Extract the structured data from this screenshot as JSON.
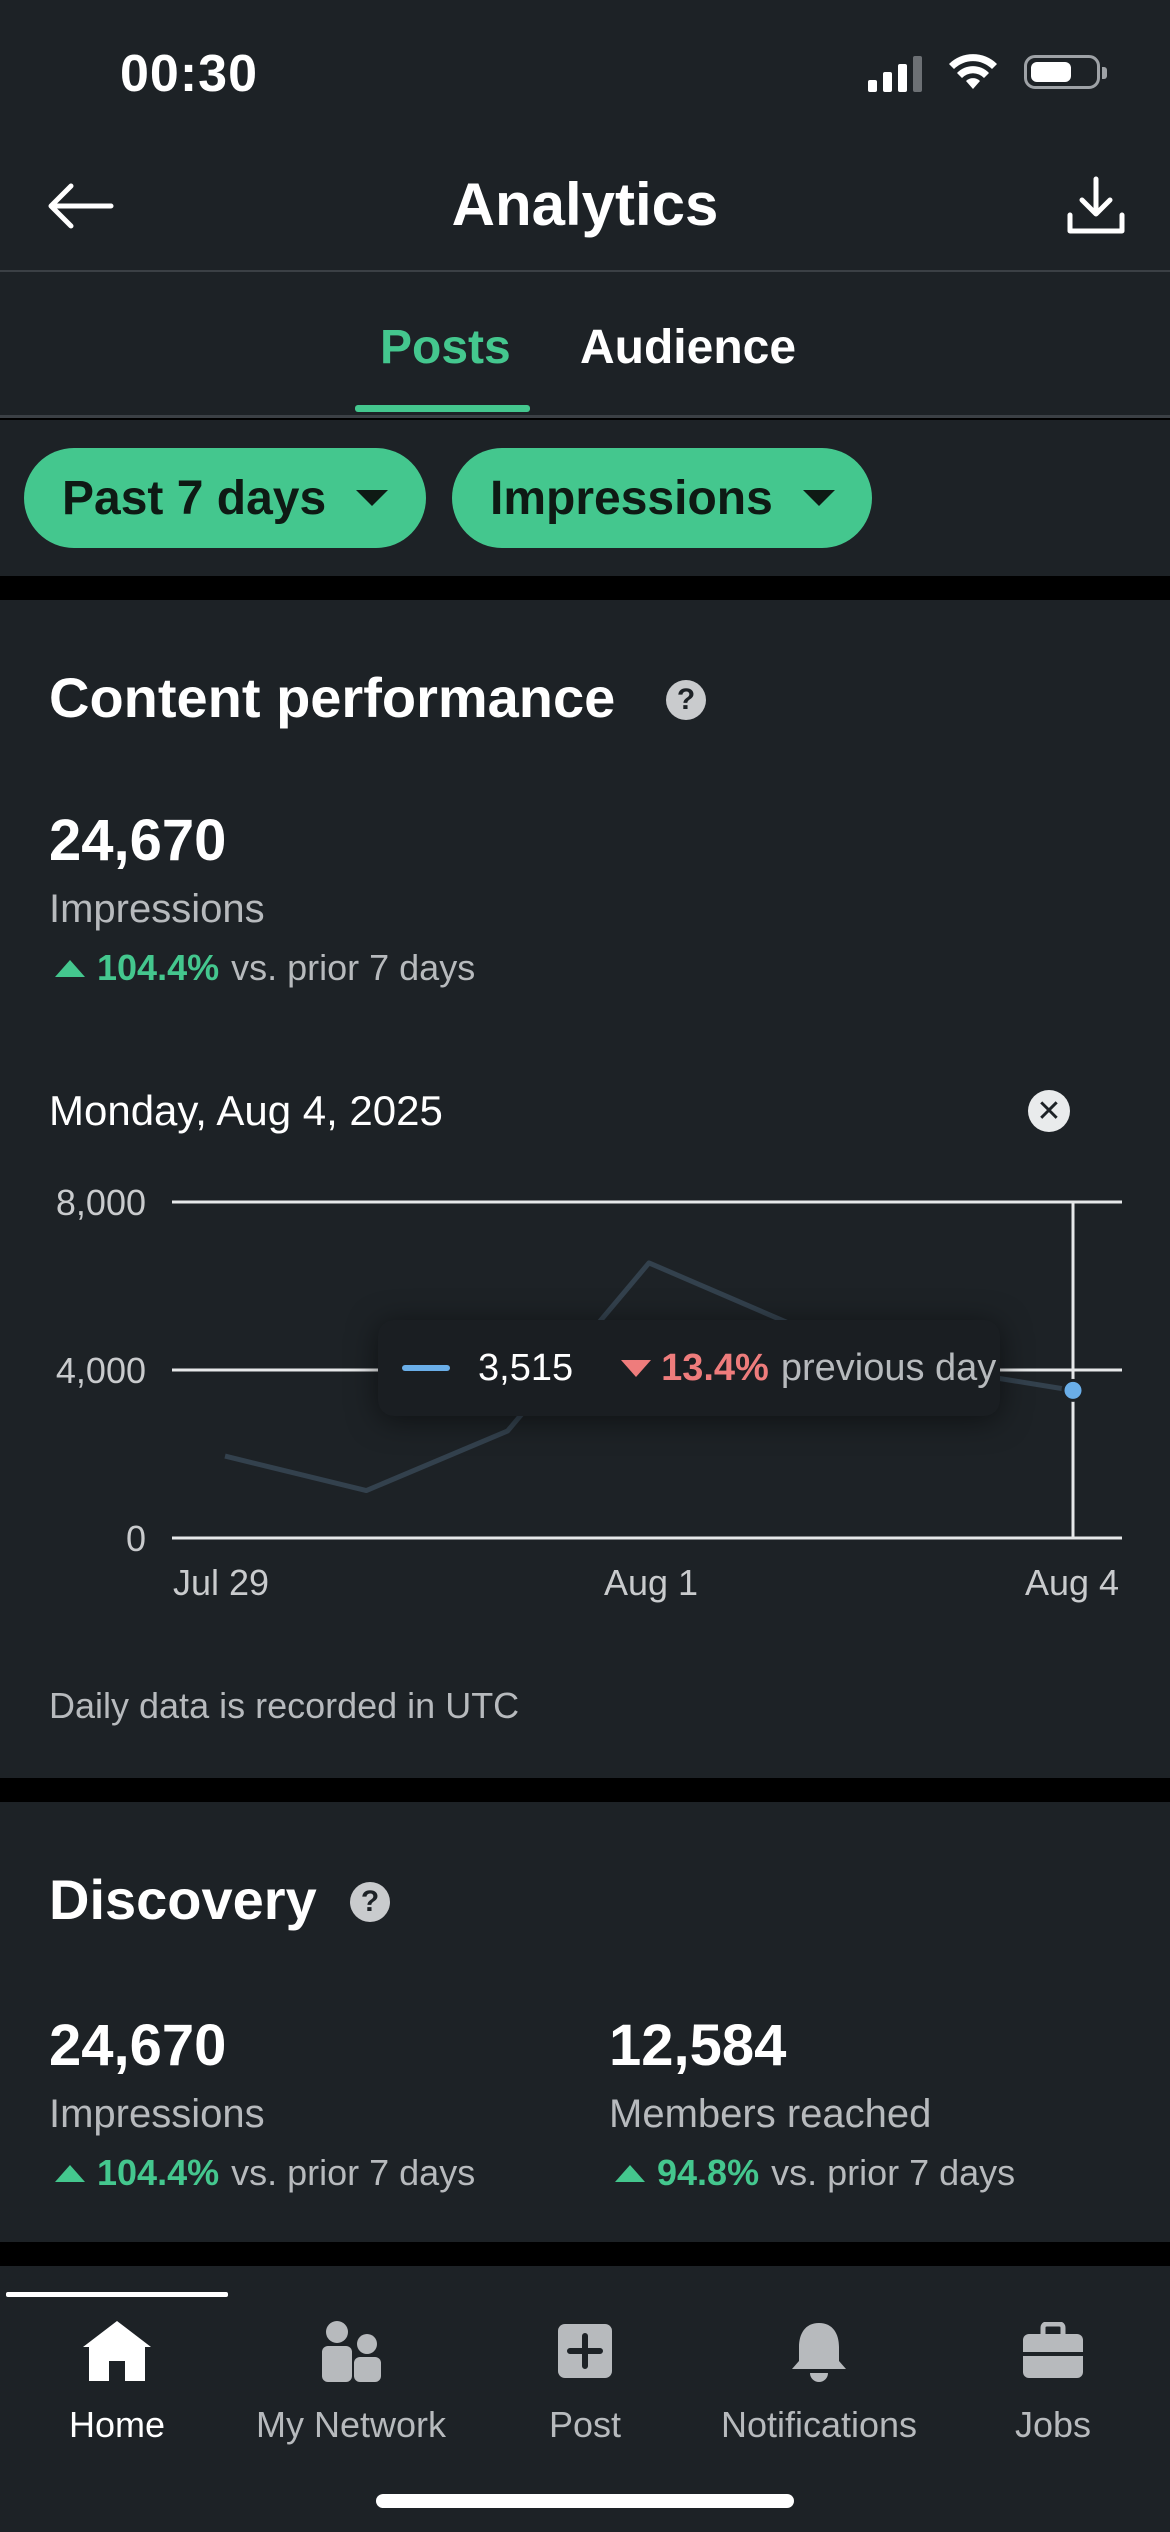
{
  "status_bar": {
    "time": "00:30"
  },
  "header": {
    "title": "Analytics"
  },
  "tabs": [
    {
      "label": "Posts",
      "active": true
    },
    {
      "label": "Audience",
      "active": false
    }
  ],
  "filters": {
    "range": "Past 7 days",
    "metric": "Impressions"
  },
  "content_performance": {
    "title": "Content performance",
    "value": "24,670",
    "label": "Impressions",
    "change_pct": "104.4%",
    "change_text": "vs. prior 7 days",
    "selected_date": "Monday, Aug 4, 2025",
    "tooltip": {
      "value": "3,515",
      "change_pct": "13.4%",
      "change_text": "previous day"
    },
    "footnote": "Daily data is recorded in UTC"
  },
  "chart_data": {
    "type": "line",
    "x": [
      "Jul 29",
      "Jul 30",
      "Jul 31",
      "Aug 1",
      "Aug 2",
      "Aug 3",
      "Aug 4"
    ],
    "x_tick_labels": [
      "Jul 29",
      "Aug 1",
      "Aug 4"
    ],
    "series": [
      {
        "values": [
          1950,
          1130,
          2550,
          6550,
          5100,
          4060,
          3515
        ]
      }
    ],
    "y_tick_labels": [
      "8,000",
      "4,000",
      "0"
    ],
    "ylim": [
      0,
      8000
    ],
    "selected_index": 6,
    "grid": true,
    "colors": {
      "line": "#33414d",
      "point": "#6aaee8",
      "grid": "#e6e8e9"
    }
  },
  "discovery": {
    "title": "Discovery",
    "metrics": [
      {
        "value": "24,670",
        "label": "Impressions",
        "change_pct": "104.4%",
        "change_text": "vs. prior 7 days"
      },
      {
        "value": "12,584",
        "label": "Members reached",
        "change_pct": "94.8%",
        "change_text": "vs. prior 7 days"
      }
    ]
  },
  "bottom_nav": [
    {
      "label": "Home",
      "icon": "home-icon",
      "active": true
    },
    {
      "label": "My Network",
      "icon": "network-icon",
      "active": false
    },
    {
      "label": "Post",
      "icon": "post-plus-icon",
      "active": false
    },
    {
      "label": "Notifications",
      "icon": "bell-icon",
      "active": false
    },
    {
      "label": "Jobs",
      "icon": "briefcase-icon",
      "active": false
    }
  ],
  "colors": {
    "accent": "#44c78e",
    "negative": "#ee7c7c",
    "background": "#1d2226"
  }
}
